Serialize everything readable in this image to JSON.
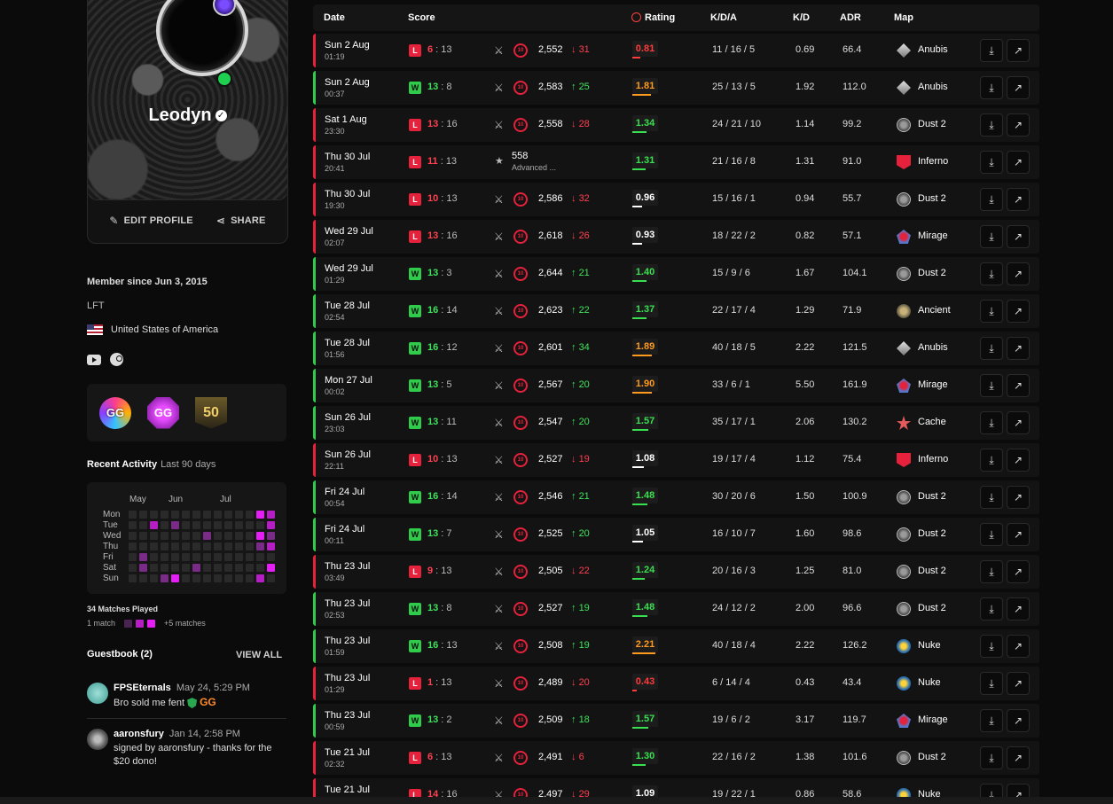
{
  "profile": {
    "username": "Leodyn",
    "edit_label": "EDIT PROFILE",
    "share_label": "SHARE",
    "member_since": "Member since Jun 3, 2015",
    "status": "LFT",
    "country": "United States of America"
  },
  "badges": [
    {
      "label": "GG",
      "icon": "gg-25-badge"
    },
    {
      "label": "GG",
      "icon": "gg-24-badge"
    },
    {
      "label": "50",
      "icon": "level-50-badge"
    }
  ],
  "activity": {
    "title": "Recent Activity",
    "subtitle": "Last 90 days",
    "months": [
      "May",
      "Jun",
      "Jul"
    ],
    "days": [
      "Mon",
      "Tue",
      "Wed",
      "Thu",
      "Fri",
      "Sat",
      "Sun"
    ],
    "grid": [
      [
        0,
        0,
        0,
        0,
        0,
        0,
        0,
        0,
        0,
        0,
        0,
        0,
        3,
        2
      ],
      [
        0,
        0,
        2,
        0,
        1,
        0,
        0,
        0,
        0,
        0,
        0,
        0,
        0,
        2
      ],
      [
        0,
        0,
        0,
        0,
        0,
        0,
        0,
        1,
        0,
        0,
        0,
        0,
        3,
        1
      ],
      [
        0,
        0,
        0,
        0,
        0,
        0,
        0,
        0,
        0,
        0,
        0,
        0,
        1,
        2
      ],
      [
        0,
        1,
        0,
        0,
        0,
        0,
        0,
        0,
        0,
        0,
        0,
        0,
        0,
        0
      ],
      [
        0,
        1,
        0,
        0,
        0,
        0,
        1,
        0,
        0,
        0,
        0,
        0,
        0,
        3
      ],
      [
        0,
        0,
        0,
        1,
        3,
        0,
        0,
        0,
        0,
        0,
        0,
        0,
        2,
        0
      ]
    ],
    "matches_played": "34 Matches Played",
    "legend_min": "1 match",
    "legend_max": "+5 matches"
  },
  "guestbook": {
    "title": "Guestbook (2)",
    "view_all": "VIEW ALL",
    "entries": [
      {
        "name": "FPSEternals",
        "date": "May 24, 5:29 PM",
        "text": "Bro sold me fent",
        "gg": "GG"
      },
      {
        "name": "aaronsfury",
        "date": "Jan 14, 2:58 PM",
        "text": "signed by aaronsfury - thanks for the $20 dono!"
      }
    ]
  },
  "table": {
    "headers": {
      "date": "Date",
      "score": "Score",
      "rating": "Rating",
      "kda": "K/D/A",
      "kd": "K/D",
      "adr": "ADR",
      "map": "Map"
    },
    "rows": [
      {
        "result": "L",
        "date": "Sun 2 Aug",
        "time": "01:19",
        "own": "6",
        "opp": "13",
        "elo": "2,552",
        "delta": "31",
        "dir": "down",
        "rating": "0.81",
        "kda": "11 / 16 / 5",
        "kd": "0.69",
        "adr": "66.4",
        "map": "Anubis"
      },
      {
        "result": "W",
        "date": "Sun 2 Aug",
        "time": "00:37",
        "own": "13",
        "opp": "8",
        "elo": "2,583",
        "delta": "25",
        "dir": "up",
        "rating": "1.81",
        "kda": "25 / 13 / 5",
        "kd": "1.92",
        "adr": "112.0",
        "map": "Anubis"
      },
      {
        "result": "L",
        "date": "Sat 1 Aug",
        "time": "23:30",
        "own": "13",
        "opp": "16",
        "elo": "2,558",
        "delta": "28",
        "dir": "down",
        "rating": "1.34",
        "kda": "24 / 21 / 10",
        "kd": "1.14",
        "adr": "99.2",
        "map": "Dust 2"
      },
      {
        "result": "L",
        "date": "Thu 30 Jul",
        "time": "20:41",
        "own": "11",
        "opp": "13",
        "elo": "558",
        "elo_sub": "Advanced ...",
        "alt": true,
        "rating": "1.31",
        "kda": "21 / 16 / 8",
        "kd": "1.31",
        "adr": "91.0",
        "map": "Inferno"
      },
      {
        "result": "L",
        "date": "Thu 30 Jul",
        "time": "19:30",
        "own": "10",
        "opp": "13",
        "elo": "2,586",
        "delta": "32",
        "dir": "down",
        "rating": "0.96",
        "kda": "15 / 16 / 1",
        "kd": "0.94",
        "adr": "55.7",
        "map": "Dust 2"
      },
      {
        "result": "L",
        "date": "Wed 29 Jul",
        "time": "02:07",
        "own": "13",
        "opp": "16",
        "elo": "2,618",
        "delta": "26",
        "dir": "down",
        "rating": "0.93",
        "kda": "18 / 22 / 2",
        "kd": "0.82",
        "adr": "57.1",
        "map": "Mirage"
      },
      {
        "result": "W",
        "date": "Wed 29 Jul",
        "time": "01:29",
        "own": "13",
        "opp": "3",
        "elo": "2,644",
        "delta": "21",
        "dir": "up",
        "rating": "1.40",
        "kda": "15 / 9 / 6",
        "kd": "1.67",
        "adr": "104.1",
        "map": "Dust 2"
      },
      {
        "result": "W",
        "date": "Tue 28 Jul",
        "time": "02:54",
        "own": "16",
        "opp": "14",
        "elo": "2,623",
        "delta": "22",
        "dir": "up",
        "rating": "1.37",
        "kda": "22 / 17 / 4",
        "kd": "1.29",
        "adr": "71.9",
        "map": "Ancient"
      },
      {
        "result": "W",
        "date": "Tue 28 Jul",
        "time": "01:56",
        "own": "16",
        "opp": "12",
        "elo": "2,601",
        "delta": "34",
        "dir": "up",
        "rating": "1.89",
        "kda": "40 / 18 / 5",
        "kd": "2.22",
        "adr": "121.5",
        "map": "Anubis"
      },
      {
        "result": "W",
        "date": "Mon 27 Jul",
        "time": "00:02",
        "own": "13",
        "opp": "5",
        "elo": "2,567",
        "delta": "20",
        "dir": "up",
        "rating": "1.90",
        "kda": "33 / 6 / 1",
        "kd": "5.50",
        "adr": "161.9",
        "map": "Mirage"
      },
      {
        "result": "W",
        "date": "Sun 26 Jul",
        "time": "23:03",
        "own": "13",
        "opp": "11",
        "elo": "2,547",
        "delta": "20",
        "dir": "up",
        "rating": "1.57",
        "kda": "35 / 17 / 1",
        "kd": "2.06",
        "adr": "130.2",
        "map": "Cache"
      },
      {
        "result": "L",
        "date": "Sun 26 Jul",
        "time": "22:11",
        "own": "10",
        "opp": "13",
        "elo": "2,527",
        "delta": "19",
        "dir": "down",
        "rating": "1.08",
        "kda": "19 / 17 / 4",
        "kd": "1.12",
        "adr": "75.4",
        "map": "Inferno"
      },
      {
        "result": "W",
        "date": "Fri 24 Jul",
        "time": "00:54",
        "own": "16",
        "opp": "14",
        "elo": "2,546",
        "delta": "21",
        "dir": "up",
        "rating": "1.48",
        "kda": "30 / 20 / 6",
        "kd": "1.50",
        "adr": "100.9",
        "map": "Dust 2"
      },
      {
        "result": "W",
        "date": "Fri 24 Jul",
        "time": "00:11",
        "own": "13",
        "opp": "7",
        "elo": "2,525",
        "delta": "20",
        "dir": "up",
        "rating": "1.05",
        "kda": "16 / 10 / 7",
        "kd": "1.60",
        "adr": "98.6",
        "map": "Dust 2"
      },
      {
        "result": "L",
        "date": "Thu 23 Jul",
        "time": "03:49",
        "own": "9",
        "opp": "13",
        "elo": "2,505",
        "delta": "22",
        "dir": "down",
        "rating": "1.24",
        "kda": "20 / 16 / 3",
        "kd": "1.25",
        "adr": "81.0",
        "map": "Dust 2"
      },
      {
        "result": "W",
        "date": "Thu 23 Jul",
        "time": "02:53",
        "own": "13",
        "opp": "8",
        "elo": "2,527",
        "delta": "19",
        "dir": "up",
        "rating": "1.48",
        "kda": "24 / 12 / 2",
        "kd": "2.00",
        "adr": "96.6",
        "map": "Dust 2"
      },
      {
        "result": "W",
        "date": "Thu 23 Jul",
        "time": "01:59",
        "own": "16",
        "opp": "13",
        "elo": "2,508",
        "delta": "19",
        "dir": "up",
        "rating": "2.21",
        "kda": "40 / 18 / 4",
        "kd": "2.22",
        "adr": "126.2",
        "map": "Nuke"
      },
      {
        "result": "L",
        "date": "Thu 23 Jul",
        "time": "01:29",
        "own": "1",
        "opp": "13",
        "elo": "2,489",
        "delta": "20",
        "dir": "down",
        "rating": "0.43",
        "kda": "6 / 14 / 4",
        "kd": "0.43",
        "adr": "43.4",
        "map": "Nuke"
      },
      {
        "result": "W",
        "date": "Thu 23 Jul",
        "time": "00:59",
        "own": "13",
        "opp": "2",
        "elo": "2,509",
        "delta": "18",
        "dir": "up",
        "rating": "1.57",
        "kda": "19 / 6 / 2",
        "kd": "3.17",
        "adr": "119.7",
        "map": "Mirage"
      },
      {
        "result": "L",
        "date": "Tue 21 Jul",
        "time": "02:32",
        "own": "6",
        "opp": "13",
        "elo": "2,491",
        "delta": "6",
        "dir": "down",
        "rating": "1.30",
        "kda": "22 / 16 / 2",
        "kd": "1.38",
        "adr": "101.6",
        "map": "Dust 2"
      },
      {
        "result": "L",
        "date": "Tue 21 Jul",
        "time": "",
        "own": "14",
        "opp": "16",
        "elo": "2,497",
        "delta": "29",
        "dir": "down",
        "rating": "1.09",
        "kda": "19 / 22 / 1",
        "kd": "0.86",
        "adr": "58.6",
        "map": "Nuke"
      }
    ]
  },
  "colors": {
    "loss": "#e5213b",
    "win": "#2ecc4a",
    "rating_red": "#ff3b3b",
    "rating_orange": "#ff9a1f",
    "rating_green": "#38e04f",
    "rating_white": "#ffffff"
  }
}
